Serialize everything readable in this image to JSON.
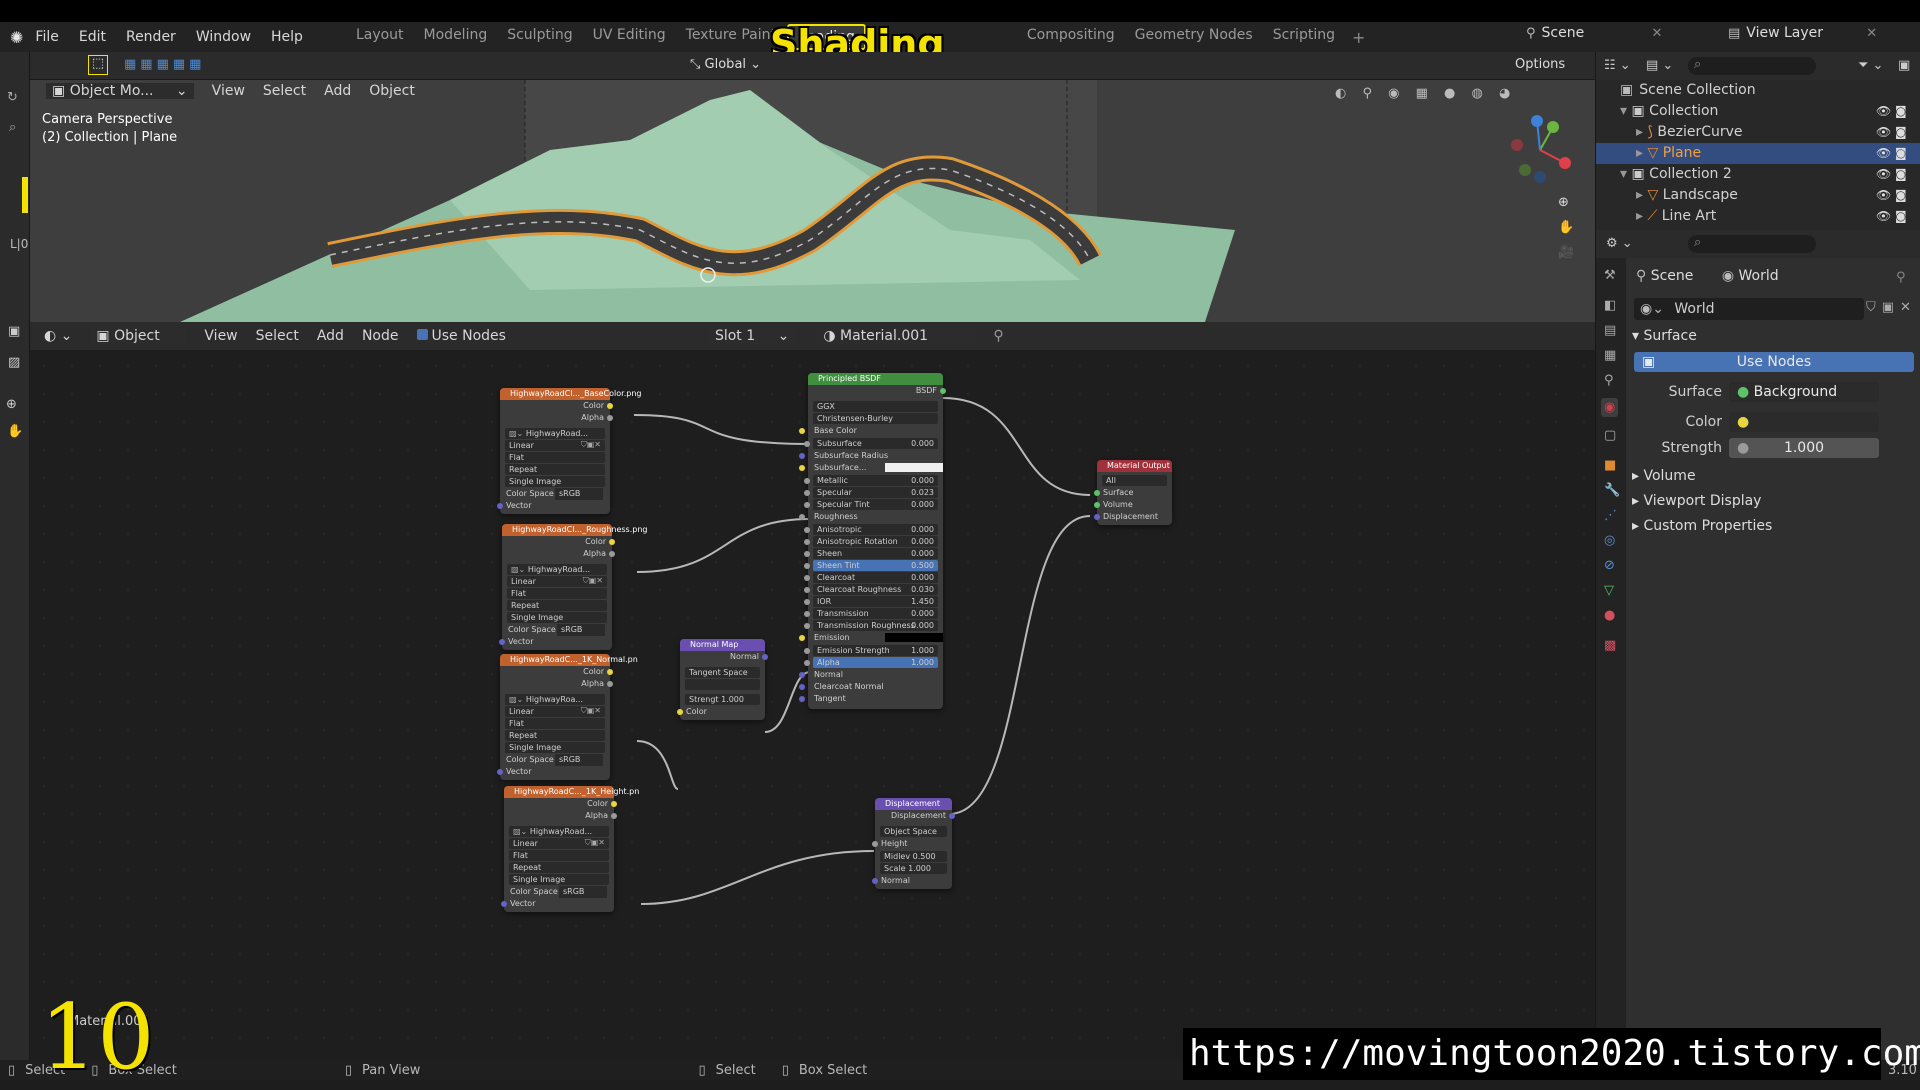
{
  "menu": [
    "File",
    "Edit",
    "Render",
    "Window",
    "Help"
  ],
  "workspace_tabs": [
    "Layout",
    "Modeling",
    "Sculpting",
    "UV Editing",
    "Texture Paint",
    "Shading",
    "Compositing",
    "Geometry Nodes",
    "Scripting"
  ],
  "active_tab": "Shading",
  "overlay_title": "Shading",
  "scene_label": "Scene",
  "view_layer_label": "View Layer",
  "transform_orientation": "Global",
  "options_label": "Options",
  "viewport_header": {
    "mode": "Object Mo...",
    "items": [
      "View",
      "Select",
      "Add",
      "Object"
    ]
  },
  "viewport_info": {
    "line1": "Camera Perspective",
    "line2": "(2) Collection | Plane",
    "frame": "L|0"
  },
  "node_header": {
    "mode": "Object",
    "items": [
      "View",
      "Select",
      "Add",
      "Node"
    ],
    "use_nodes": "Use Nodes",
    "slot": "Slot 1",
    "material": "Material.001"
  },
  "outliner": {
    "root": "Scene Collection",
    "rows": [
      {
        "name": "Collection",
        "indent": 1
      },
      {
        "name": "BezierCurve",
        "indent": 2
      },
      {
        "name": "Plane",
        "indent": 2,
        "selected": true
      },
      {
        "name": "Collection 2",
        "indent": 1
      },
      {
        "name": "Landscape",
        "indent": 2
      },
      {
        "name": "Line Art",
        "indent": 2
      }
    ]
  },
  "properties": {
    "breadcrumb_scene": "Scene",
    "breadcrumb_world": "World",
    "world_name": "World",
    "surface_section": "Surface",
    "use_nodes_btn": "Use Nodes",
    "surface_label": "Surface",
    "surface_value": "Background",
    "color_label": "Color",
    "strength_label": "Strength",
    "strength_value": "1.000",
    "sections": [
      "Volume",
      "Viewport Display",
      "Custom Properties"
    ]
  },
  "nodes": {
    "tex1": {
      "title": "HighwayRoadCl..._BaseColor.png",
      "img": "HighwayRoad...",
      "interp": "Linear",
      "proj": "Flat",
      "ext": "Repeat",
      "src": "Single Image",
      "cs_label": "Color Space",
      "cs": "sRGB"
    },
    "tex2": {
      "title": "HighwayRoadCl..._Roughness.png",
      "img": "HighwayRoad...",
      "interp": "Linear",
      "proj": "Flat",
      "ext": "Repeat",
      "src": "Single Image",
      "cs_label": "Color Space",
      "cs": "sRGB"
    },
    "tex3": {
      "title": "HighwayRoadC..._1K_Normal.pn",
      "img": "HighwayRoa...",
      "interp": "Linear",
      "proj": "Flat",
      "ext": "Repeat",
      "src": "Single Image",
      "cs_label": "Color Space",
      "cs": "sRGB"
    },
    "tex4": {
      "title": "HighwayRoadC..._1K_Height.pn",
      "img": "HighwayRoad...",
      "interp": "Linear",
      "proj": "Flat",
      "ext": "Repeat",
      "src": "Single Image",
      "cs_label": "Color Space",
      "cs": "sRGB"
    },
    "sock_color": "Color",
    "sock_alpha": "Alpha",
    "sock_vector": "Vector",
    "bsdf": {
      "title": "Principled BSDF",
      "out": "BSDF",
      "dist": "GGX",
      "sss": "Christensen-Burley",
      "rows": [
        {
          "l": "Base Color",
          "v": ""
        },
        {
          "l": "Subsurface",
          "v": "0.000"
        },
        {
          "l": "Subsurface Radius",
          "v": ""
        },
        {
          "l": "Subsurface...",
          "v": ""
        },
        {
          "l": "Metallic",
          "v": "0.000"
        },
        {
          "l": "Specular",
          "v": "0.023"
        },
        {
          "l": "Specular Tint",
          "v": "0.000"
        },
        {
          "l": "Roughness",
          "v": ""
        },
        {
          "l": "Anisotropic",
          "v": "0.000"
        },
        {
          "l": "Anisotropic Rotation",
          "v": "0.000"
        },
        {
          "l": "Sheen",
          "v": "0.000"
        },
        {
          "l": "Sheen Tint",
          "v": "0.500"
        },
        {
          "l": "Clearcoat",
          "v": "0.000"
        },
        {
          "l": "Clearcoat Roughness",
          "v": "0.030"
        },
        {
          "l": "IOR",
          "v": "1.450"
        },
        {
          "l": "Transmission",
          "v": "0.000"
        },
        {
          "l": "Transmission Roughness",
          "v": "0.000"
        },
        {
          "l": "Emission",
          "v": ""
        },
        {
          "l": "Emission Strength",
          "v": "1.000"
        },
        {
          "l": "Alpha",
          "v": "1.000"
        },
        {
          "l": "Normal",
          "v": ""
        },
        {
          "l": "Clearcoat Normal",
          "v": ""
        },
        {
          "l": "Tangent",
          "v": ""
        }
      ]
    },
    "normalmap": {
      "title": "Normal Map",
      "out": "Normal",
      "space": "Tangent Space",
      "strength": "Strengt 1.000",
      "in": "Color"
    },
    "displacement": {
      "title": "Displacement",
      "out": "Displacement",
      "space": "Object Space",
      "height": "Height",
      "midlevel": "Midlev 0.500",
      "scale": "Scale 1.000",
      "normal": "Normal"
    },
    "output": {
      "title": "Material Output",
      "target": "All",
      "surface": "Surface",
      "volume": "Volume",
      "displacement": "Displacement"
    }
  },
  "bottom_left_text": "Material.001",
  "status": {
    "left": [
      "Select",
      "Box Select",
      "Pan View"
    ],
    "mid": [
      "Select",
      "Box Select"
    ],
    "version": "3.10"
  },
  "overlay_number": "10",
  "url": "https://movingtoon2020.tistory.com",
  "colors": {
    "accent_yellow": "#f4e300",
    "selected_blue": "#4772b3",
    "tex_header": "#c0612e",
    "bsdf_header": "#3f8f3f",
    "vector_header": "#6a4fb0",
    "output_header": "#a0303a"
  }
}
